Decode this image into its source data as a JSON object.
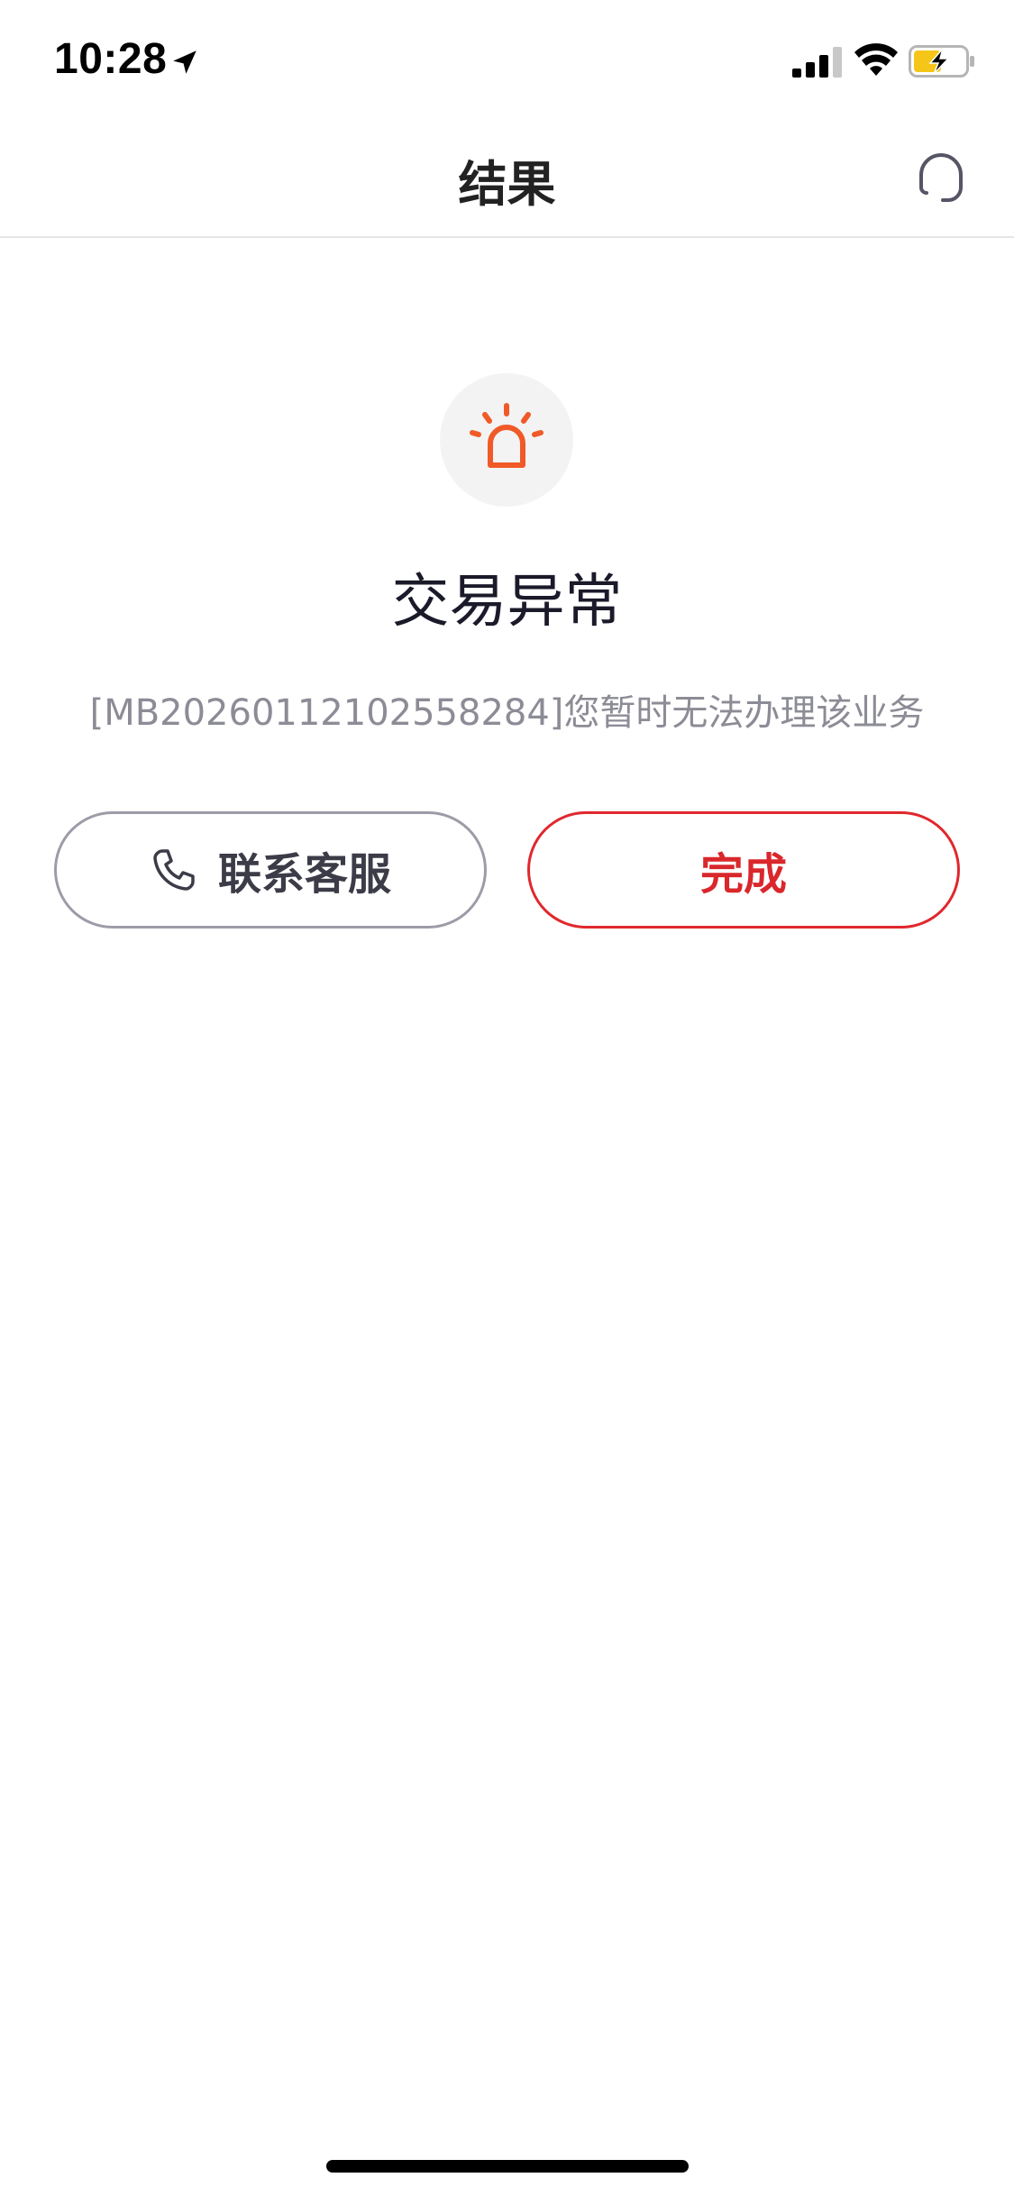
{
  "status_bar": {
    "time": "10:28",
    "icons": [
      "location-arrow-icon",
      "cellular-signal-icon",
      "wifi-icon",
      "battery-charging-icon"
    ],
    "battery_color": "#f5c518"
  },
  "nav": {
    "title": "结果",
    "right_icon": "customer-service-headset-icon"
  },
  "result": {
    "status_icon": "alarm-siren-icon",
    "status_icon_color": "#f05a28",
    "title": "交易异常",
    "message": "[MB20260112102558284]您暂时无法办理该业务"
  },
  "actions": {
    "contact_label": "联系客服",
    "contact_icon": "phone-icon",
    "done_label": "完成",
    "done_color": "#d9272c"
  }
}
